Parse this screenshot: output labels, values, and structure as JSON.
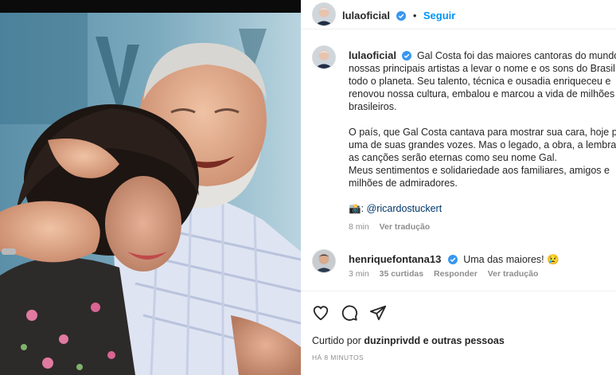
{
  "post": {
    "username": "lulaoficial",
    "follow_label": "Seguir",
    "separator": "•",
    "caption_lines": [
      "Gal Costa foi das maiores cantoras do mundo, d",
      "nossas principais artistas a levar o nome e os sons do Brasil p",
      "todo o planeta. Seu talento, técnica e ousadia enriqueceu e",
      "renovou nossa cultura, embalou e marcou a vida de milhões",
      "brasileiros.",
      "",
      "O país, que Gal Costa cantava para mostrar sua cara, hoje pe",
      "uma de suas grandes vozes. Mas o legado, a obra, a lembran",
      "as canções serão eternas como seu nome Gal.",
      "Meus sentimentos e solidariedade aos familiares, amigos e",
      "milhões de admiradores.",
      "",
      "📸: @ricardostuckert"
    ],
    "caption_time": "8 min",
    "caption_translate": "Ver tradução"
  },
  "comment": {
    "username": "henriquefontana13",
    "text": "Uma das maiores! 😢",
    "time": "3 min",
    "likes": "35 curtidas",
    "reply": "Responder",
    "translate": "Ver tradução"
  },
  "actions": {
    "liked_prefix": "Curtido por",
    "liked_user": "duzinprivdd",
    "liked_suffix": "e outras pessoas",
    "time_ago": "HÁ 8 MINUTOS"
  },
  "icons": {
    "like": "heart-icon",
    "comment": "comment-icon",
    "share": "share-icon",
    "verified": "verified-badge-icon"
  },
  "colors": {
    "accent": "#0095f6",
    "verified": "#3897f0",
    "muted": "#8e8e8e",
    "text": "#262626"
  }
}
